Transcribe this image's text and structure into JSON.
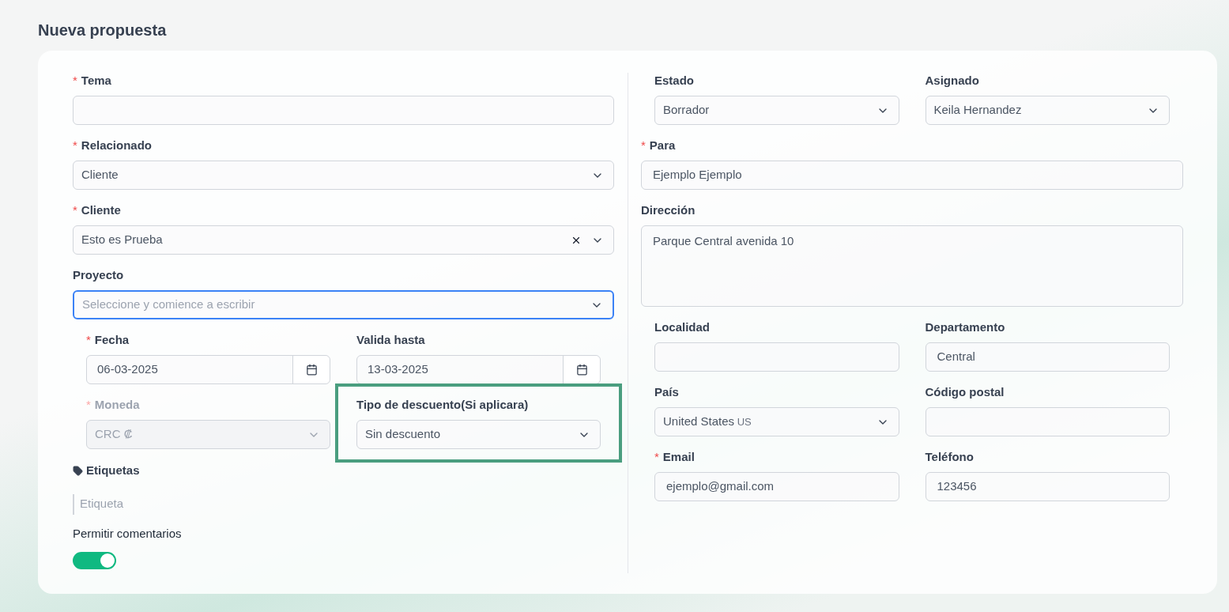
{
  "title": "Nueva propuesta",
  "left": {
    "rows": [
      [
        {
          "kind": "input",
          "label": "Tema",
          "asterisk": "*"
        }
      ],
      [
        {
          "kind": "select",
          "label": "Relacionado",
          "asterisk": "*",
          "value": "Cliente"
        }
      ],
      [
        {
          "kind": "select",
          "label": "Cliente",
          "asterisk": "*",
          "value": "Esto es Prueba",
          "clearable": true
        }
      ],
      [
        {
          "kind": "select",
          "label": "Proyecto",
          "focused": true,
          "placeholder": "Seleccione y comience a escribir"
        }
      ],
      [
        {
          "kind": "date",
          "label": "Fecha",
          "asterisk": "*",
          "value": "06-03-2025"
        },
        {
          "kind": "date",
          "label": "Valida hasta",
          "value": "13-03-2025"
        }
      ],
      [
        {
          "kind": "select",
          "label": "Moneda",
          "asterisk": "*",
          "disabled": true,
          "value": "CRC ₡"
        },
        {
          "kind": "select",
          "label": "Tipo de descuento(Si aplicara)",
          "highlighted": true,
          "value": "Sin descuento"
        }
      ]
    ],
    "tags": {
      "label": "Etiquetas",
      "placeholder": "Etiqueta"
    },
    "comments": {
      "label": "Permitir comentarios",
      "on": true
    }
  },
  "right": {
    "rows": [
      [
        {
          "kind": "select",
          "label": "Estado",
          "value": "Borrador"
        },
        {
          "kind": "select",
          "label": "Asignado",
          "value": "Keila Hernandez"
        }
      ],
      [
        {
          "kind": "input",
          "label": "Para",
          "asterisk": "*",
          "value": "Ejemplo Ejemplo"
        }
      ],
      [
        {
          "kind": "textarea",
          "label": "Dirección",
          "value": "Parque Central avenida 10"
        }
      ],
      [
        {
          "kind": "input",
          "label": "Localidad"
        },
        {
          "kind": "input",
          "label": "Departamento",
          "value": "Central"
        }
      ],
      [
        {
          "kind": "select",
          "label": "País",
          "value": "United States",
          "suffix": "US"
        },
        {
          "kind": "input",
          "label": "Código postal"
        }
      ],
      [
        {
          "kind": "input",
          "label": "Email",
          "asterisk": "*",
          "value": "ejemplo@gmail.com"
        },
        {
          "kind": "input",
          "label": "Teléfono",
          "value": "123456"
        }
      ]
    ]
  }
}
